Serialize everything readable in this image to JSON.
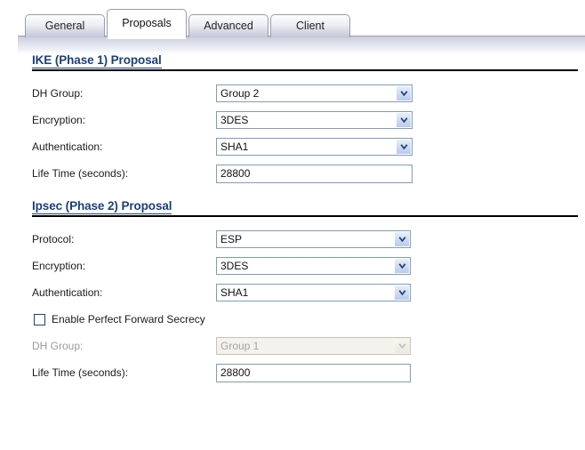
{
  "tabs": [
    {
      "label": "General",
      "active": false
    },
    {
      "label": "Proposals",
      "active": true
    },
    {
      "label": "Advanced",
      "active": false
    },
    {
      "label": "Client",
      "active": false
    }
  ],
  "phase1": {
    "title": "IKE (Phase 1) Proposal",
    "dh_group_label": "DH Group:",
    "dh_group_value": "Group 2",
    "encryption_label": "Encryption:",
    "encryption_value": "3DES",
    "authentication_label": "Authentication:",
    "authentication_value": "SHA1",
    "lifetime_label": "Life Time (seconds):",
    "lifetime_value": "28800"
  },
  "phase2": {
    "title": "Ipsec (Phase 2) Proposal",
    "protocol_label": "Protocol:",
    "protocol_value": "ESP",
    "encryption_label": "Encryption:",
    "encryption_value": "3DES",
    "authentication_label": "Authentication:",
    "authentication_value": "SHA1",
    "pfs_label": "Enable Perfect Forward Secrecy",
    "pfs_checked": false,
    "dh_group_label": "DH Group:",
    "dh_group_value": "Group 1",
    "dh_group_disabled": true,
    "lifetime_label": "Life Time (seconds):",
    "lifetime_value": "28800"
  },
  "colors": {
    "heading": "#1d3f7a",
    "control_border": "#7f9db9",
    "arrow": "#1f3f7a",
    "disabled_bg": "#f3f2ec",
    "disabled_text": "#a6a6a6"
  }
}
